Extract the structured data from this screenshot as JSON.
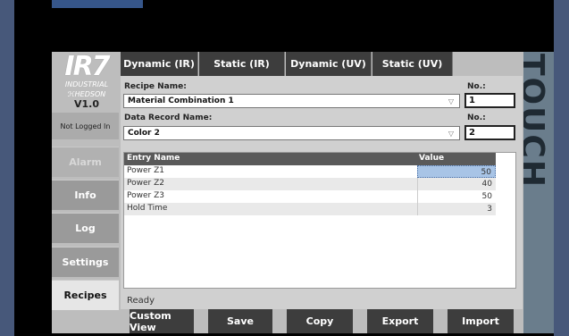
{
  "brand": {
    "logo_main": "IR7",
    "logo_sub": "INDUSTRIAL",
    "logo_hedson": "HEDSON",
    "version": "V1.0",
    "side_label": "TOUCH"
  },
  "sidebar": {
    "login_status": "Not Logged In",
    "items": [
      {
        "label": "Alarm",
        "state": "disabled"
      },
      {
        "label": "Info",
        "state": "normal"
      },
      {
        "label": "Log",
        "state": "normal"
      },
      {
        "label": "Settings",
        "state": "normal"
      },
      {
        "label": "Recipes",
        "state": "active"
      }
    ]
  },
  "tabs": [
    {
      "label": "Dynamic (IR)"
    },
    {
      "label": "Static (IR)"
    },
    {
      "label": "Dynamic (UV)"
    },
    {
      "label": "Static (UV)"
    }
  ],
  "recipe": {
    "name_label": "Recipe Name:",
    "name_value": "Material Combination 1",
    "no_label": "No.:",
    "no_value": "1"
  },
  "data_record": {
    "name_label": "Data Record Name:",
    "name_value": "Color 2",
    "no_label": "No.:",
    "no_value": "2"
  },
  "table": {
    "col_name": "Entry Name",
    "col_value": "Value",
    "rows": [
      {
        "name": "Power Z1",
        "value": "50"
      },
      {
        "name": "Power Z2",
        "value": "40"
      },
      {
        "name": "Power Z3",
        "value": "50"
      },
      {
        "name": "Hold Time",
        "value": "3"
      }
    ]
  },
  "status_text": "Ready",
  "bottom_buttons": [
    {
      "label": "Custom View"
    },
    {
      "label": "Save"
    },
    {
      "label": "Copy"
    },
    {
      "label": "Export"
    },
    {
      "label": "Import"
    }
  ],
  "colors": {
    "dark_button": "#3d3d3d",
    "panel_gray": "#bdbdbd",
    "selection_blue": "#a8c4e6",
    "frame_blue": "#47587a"
  }
}
